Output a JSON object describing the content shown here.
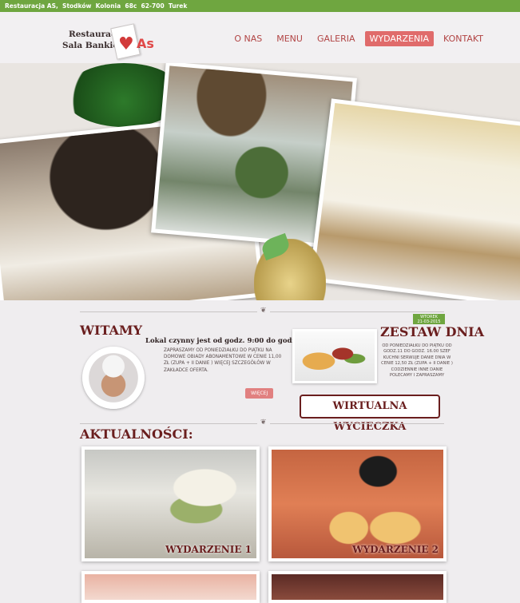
{
  "topbar": {
    "address": "Restauracja AS,  Stodków  Kolonia  68c  62-700  Turek"
  },
  "logo": {
    "line1": "Restauracja",
    "line2": "Sala Bankietowa",
    "brand": "As"
  },
  "nav": [
    {
      "label": "O NAS",
      "active": false
    },
    {
      "label": "MENU",
      "active": false
    },
    {
      "label": "GALERIA",
      "active": false
    },
    {
      "label": "WYDARZENIA",
      "active": true
    },
    {
      "label": "KONTAKT",
      "active": false
    }
  ],
  "witamy": {
    "title": "WITAMY",
    "hours": "Lokal czynny jest od godz. 9:00 do godz. 22:00",
    "text": "ZAPRASZAMY OD PONIEDZIAŁKU DO PIĄTKU NA DOMOWE OBIADY ABONAMENTOWE W CENIE 11,00 ZŁ (ZUPA + II DANIE ) WIĘCEJ SZCZEGÓŁÓW W ZAKŁADCE OFERTA.",
    "button": "WIĘCEJ"
  },
  "zestaw": {
    "badge_day": "WTOREK",
    "badge_date": "21-03-2015",
    "title": "ZESTAW DNIA",
    "text": "OD PONIEDZIAŁKU DO PIĄTKU OD GODZ.11 DO GODZ. 16.00 SZEF KUCHNI SERWUJE DANIE DNIA W CENIE 12,50 ZŁ (ZUPA + II DANIE ) CODZIENNIE INNE DANIE POLECAMY I ZAPRASZAMY"
  },
  "virtual_tour": "WIRTUALNA WYCIECZKA",
  "aktualnosci": {
    "title": "AKTUALNOŚCI:",
    "items": [
      {
        "label": "WYDARZENIE 1"
      },
      {
        "label": "WYDARZENIE 2"
      }
    ]
  },
  "colors": {
    "accent": "#e06b6b",
    "topbar": "#6fa640",
    "heading": "#6a1e1e"
  }
}
